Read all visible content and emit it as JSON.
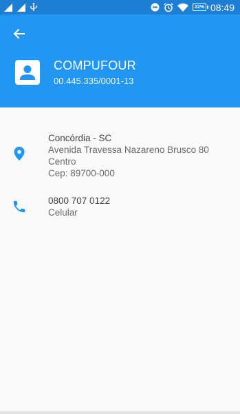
{
  "status_bar": {
    "time": "08:49",
    "battery_level": "22%"
  },
  "header": {
    "company_name": "COMPUFOUR",
    "company_id": "00.445.335/0001-13"
  },
  "address": {
    "city_state": "Concórdia - SC",
    "street": "Avenida Travessa Nazareno Brusco 80",
    "district": "Centro",
    "zip": "Cep: 89700-000"
  },
  "phone": {
    "number": "0800 707 0122",
    "type": "Celular"
  },
  "colors": {
    "primary": "#2196f3",
    "status_bar": "#1e7ed4",
    "icon_accent": "#2196f3"
  }
}
